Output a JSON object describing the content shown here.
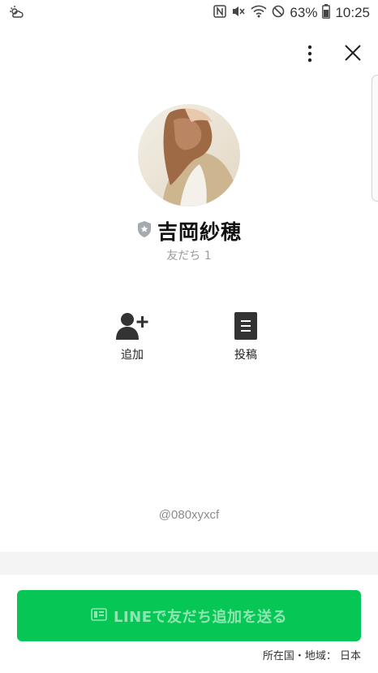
{
  "status_bar": {
    "battery_percent": "63%",
    "time": "10:25",
    "icons": [
      "weather-icon",
      "nfc-icon",
      "mute-icon",
      "wifi-icon",
      "dnd-icon",
      "battery-icon"
    ]
  },
  "header": {
    "icons": [
      "more-vertical-icon",
      "close-icon"
    ]
  },
  "profile": {
    "name": "吉岡紗穂",
    "friends_label": "友だち 1",
    "badge_icon": "official-shield-icon"
  },
  "actions": [
    {
      "label": "追加",
      "icon": "add-friend-icon"
    },
    {
      "label": "投稿",
      "icon": "post-icon"
    }
  ],
  "line_id": "@080xyxcf",
  "cta": {
    "label": "LINEで友だち追加を送る",
    "color": "#06c755"
  },
  "region": "所在国・地域： 日本"
}
